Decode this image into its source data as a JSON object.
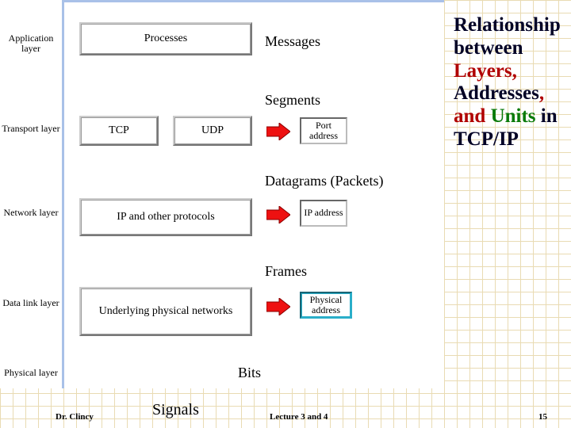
{
  "title": {
    "pre": "Relationship between ",
    "layers": "Layers",
    "c1": ", ",
    "addresses": "Addresses",
    "c2": ", and ",
    "units": "Units",
    "post": " in TCP/IP"
  },
  "layers": {
    "app": "Application layer",
    "trans": "Transport layer",
    "net": "Network layer",
    "dl": "Data link layer",
    "phys": "Physical layer"
  },
  "boxes": {
    "proc": "Processes",
    "tcp": "TCP",
    "udp": "UDP",
    "ip": "IP and other protocols",
    "upn": "Underlying physical networks"
  },
  "units": {
    "msg": "Messages",
    "seg": "Segments",
    "dg": "Datagrams (Packets)",
    "fr": "Frames",
    "bits": "Bits",
    "signals": "Signals"
  },
  "addresses": {
    "port": "Port address",
    "ip": "IP address",
    "phys": "Physical address"
  },
  "footer": {
    "author": "Dr. Clincy",
    "center": "Lecture 3 and 4",
    "page": "15"
  }
}
